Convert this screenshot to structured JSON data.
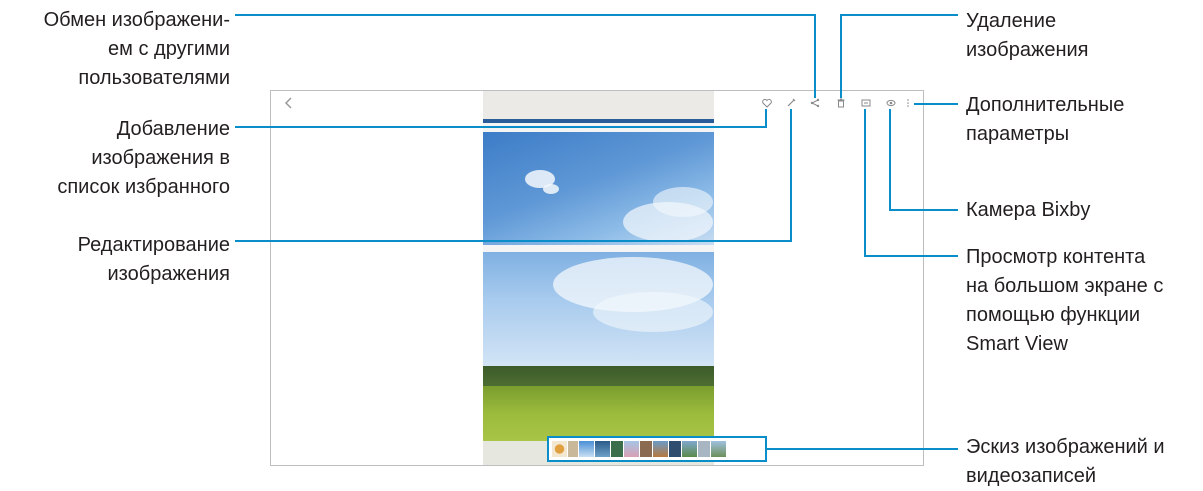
{
  "labels": {
    "share": [
      "Обмен изображени-",
      "ем с другими",
      "пользователями"
    ],
    "favorite": [
      "Добавление",
      "изображения в",
      "список избранного"
    ],
    "edit": [
      "Редактирование",
      "изображения"
    ],
    "delete": [
      "Удаление",
      "изображения"
    ],
    "more": [
      "Дополнительные",
      "параметры"
    ],
    "bixby": [
      "Камера Bixby"
    ],
    "smart_view": [
      "Просмотр контента",
      "на большом экране с",
      "помощью функции",
      "Smart View"
    ],
    "thumbnails": [
      "Эскиз изображений и",
      "видеозаписей"
    ]
  },
  "icons": {
    "back": "chevron-left-icon",
    "favorite": "heart-icon",
    "edit": "pencil-icon",
    "share": "share-icon",
    "delete": "trash-icon",
    "smart_view": "smart-view-icon",
    "bixby": "bixby-vision-icon",
    "more": "more-vertical-icon"
  },
  "colors": {
    "callout": "#0a8ec9",
    "text": "#231f20",
    "frame": "#bcbec0"
  }
}
